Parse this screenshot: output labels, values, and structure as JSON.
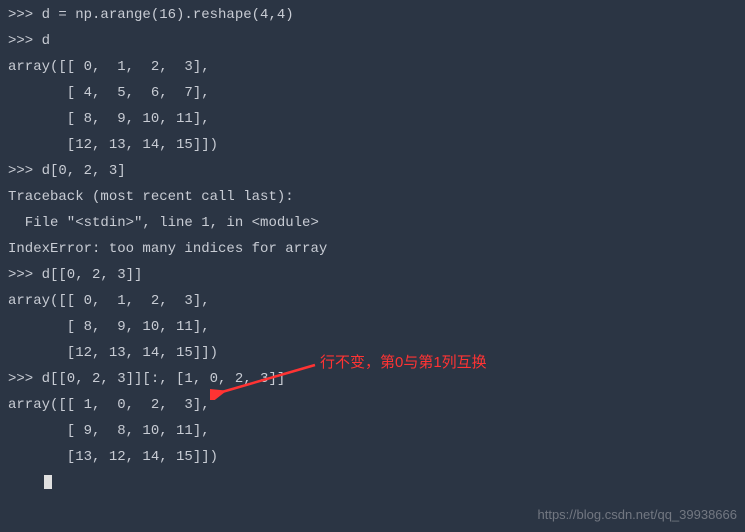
{
  "lines": {
    "l0": ">>> d = np.arange(16).reshape(4,4)",
    "l1": ">>> d",
    "l2": "array([[ 0,  1,  2,  3],",
    "l3": "       [ 4,  5,  6,  7],",
    "l4": "       [ 8,  9, 10, 11],",
    "l5": "       [12, 13, 14, 15]])",
    "l6": ">>> d[0, 2, 3]",
    "l7": "Traceback (most recent call last):",
    "l8": "  File \"<stdin>\", line 1, in <module>",
    "l9": "IndexError: too many indices for array",
    "l10": ">>> d[[0, 2, 3]]",
    "l11": "array([[ 0,  1,  2,  3],",
    "l12": "       [ 8,  9, 10, 11],",
    "l13": "       [12, 13, 14, 15]])",
    "l14": ">>> d[[0, 2, 3]][:, [1, 0, 2, 3]]",
    "l15": "array([[ 1,  0,  2,  3],",
    "l16": "       [ 9,  8, 10, 11],",
    "l17": "       [13, 12, 14, 15]])"
  },
  "annotation_text": "行不变，第0与第1列互换",
  "watermark_text": "https://blog.csdn.net/qq_39938666"
}
